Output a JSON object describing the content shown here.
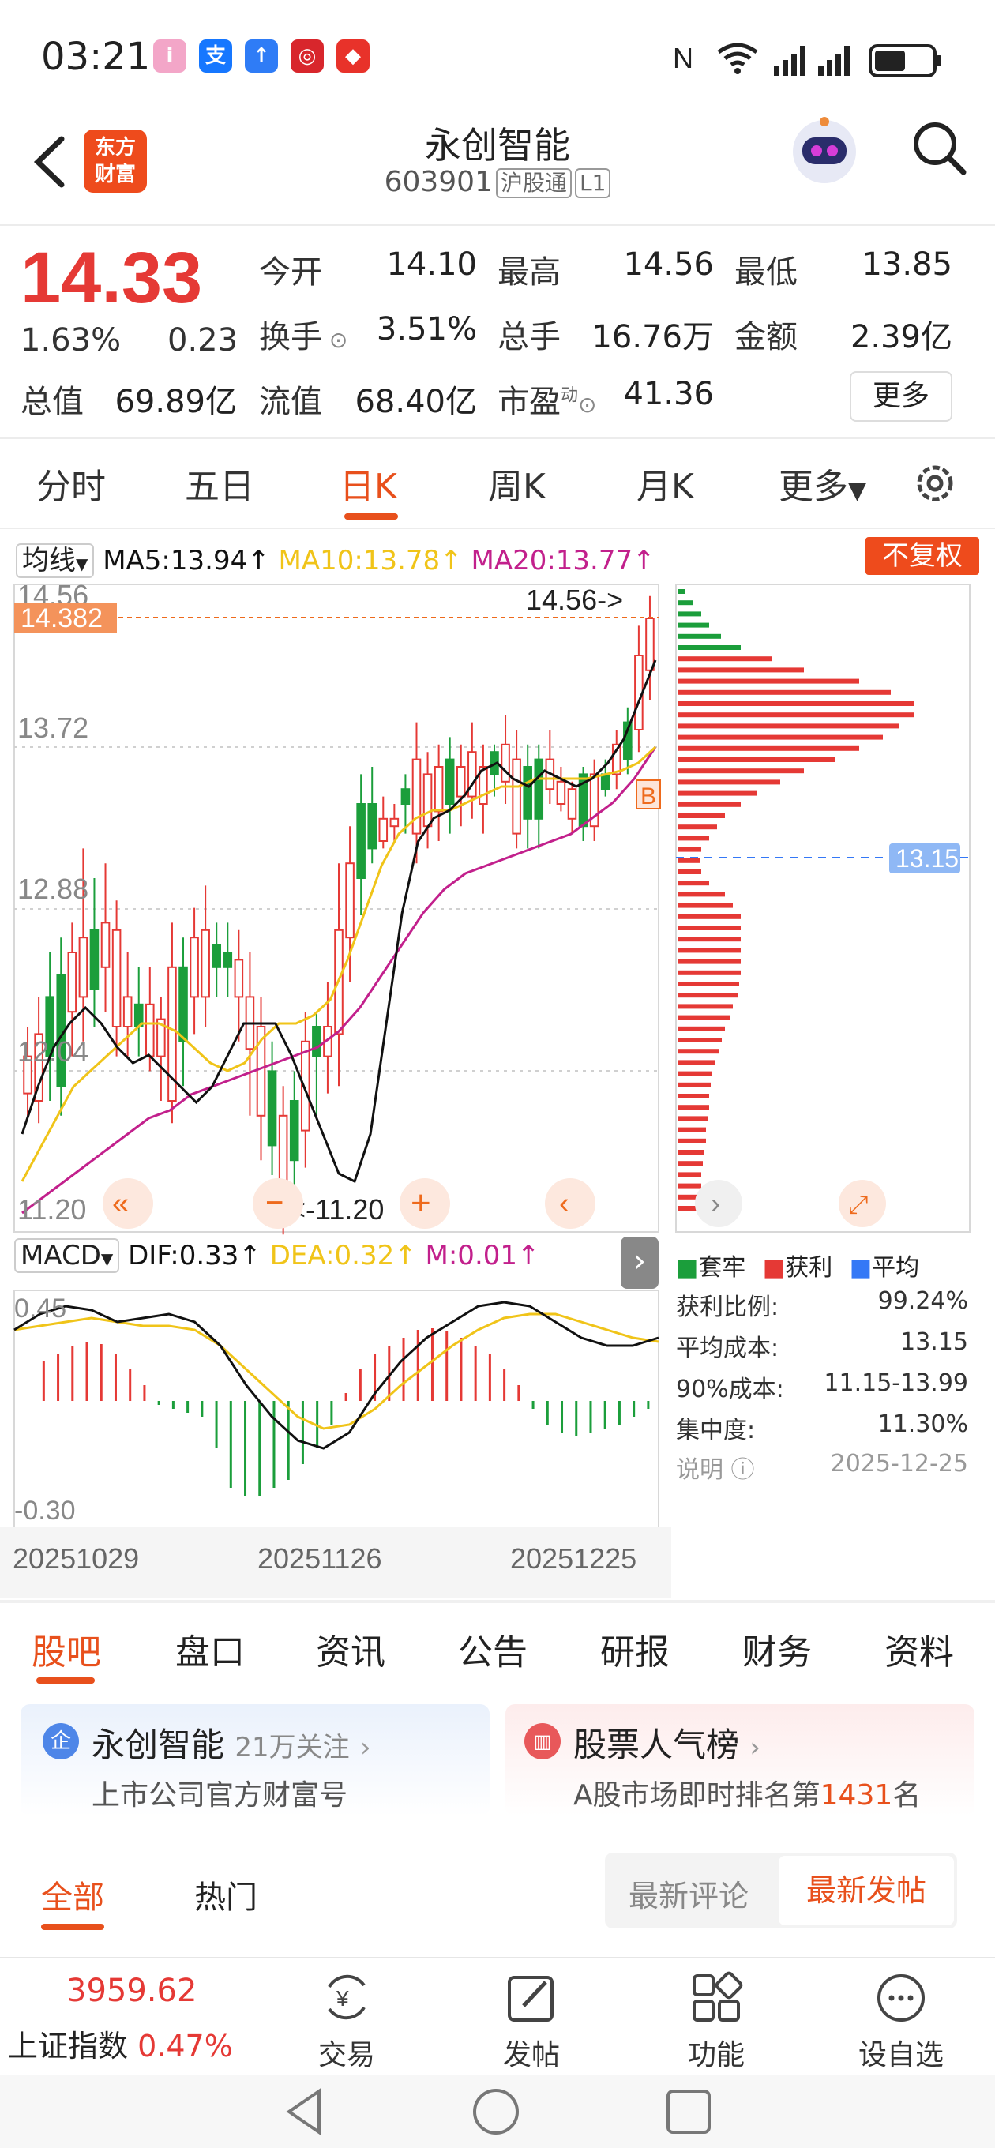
{
  "status": {
    "time": "03:21"
  },
  "header": {
    "logo_line1": "东方",
    "logo_line2": "财富",
    "title": "永创智能",
    "code": "603901",
    "tag1": "沪股通",
    "tag2": "L1"
  },
  "quote": {
    "price": "14.33",
    "pct": "1.63%",
    "change": "0.23",
    "rows": [
      {
        "label": "今开",
        "value": "14.10",
        "label2": "最高",
        "value2": "14.56",
        "label3": "最低",
        "value3": "13.85"
      },
      {
        "label": "换手",
        "value": "3.51%",
        "label2": "总手",
        "value2": "16.76万",
        "label3": "金额",
        "value3": "2.39亿"
      },
      {
        "label": "总值",
        "value": "69.89亿",
        "label2": "流值",
        "value2": "68.40亿",
        "label3": "市盈",
        "value3": "41.36",
        "sup3": "动"
      }
    ],
    "more": "更多"
  },
  "ktabs": [
    "分时",
    "五日",
    "日K",
    "周K",
    "月K",
    "更多"
  ],
  "ma": {
    "selector": "均线",
    "ma5": "MA5:13.94↑",
    "ma10": "MA10:13.78↑",
    "ma20": "MA20:13.77↑",
    "fuquan": "不复权",
    "colors": {
      "ma5": "#111111",
      "ma10": "#f0c419",
      "ma20": "#c2208c"
    }
  },
  "kchart": {
    "axis_labels": [
      "14.56",
      "13.72",
      "12.88",
      "12.04",
      "11.20"
    ],
    "cross_price": "14.382",
    "high_marker": "14.56->",
    "low_marker": "<-11.20",
    "b_marker": "B",
    "chip_avg_label": "13.15"
  },
  "macd": {
    "selector": "MACD",
    "dif": "DIF:0.33↑",
    "dea": "DEA:0.32↑",
    "m": "M:0.01↑",
    "top": "0.45",
    "bottom": "-0.30"
  },
  "dates": [
    "20251029",
    "20251126",
    "20251225"
  ],
  "chip": {
    "legend": [
      {
        "label": "套牢",
        "color": "#1b9e3b"
      },
      {
        "label": "获利",
        "color": "#e53935"
      },
      {
        "label": "平均",
        "color": "#3478f6"
      }
    ],
    "rows": [
      {
        "label": "获利比例:",
        "value": "99.24%"
      },
      {
        "label": "平均成本:",
        "value": "13.15"
      },
      {
        "label": "90%成本:",
        "value": "11.15-13.99"
      },
      {
        "label": "集中度:",
        "value": "11.30%"
      }
    ],
    "note": "说明",
    "date": "2025-12-25"
  },
  "btabs": [
    "股吧",
    "盘口",
    "资讯",
    "公告",
    "研报",
    "财务",
    "资料"
  ],
  "cards": {
    "c1_title": "永创智能",
    "c1_follow": "21万关注",
    "c1_sub": "上市公司官方财富号",
    "c2_title": "股票人气榜",
    "c2_sub_pre": "A股市场即时排名第",
    "c2_rank": "1431",
    "c2_sub_post": "名"
  },
  "subtabs": {
    "all": "全部",
    "hot": "热门",
    "latest_comment": "最新评论",
    "latest_post": "最新发帖"
  },
  "bottom": {
    "index_value": "3959.62",
    "index_name": "上证指数",
    "index_pct": "0.47%",
    "nav": [
      "交易",
      "发帖",
      "功能",
      "设自选"
    ]
  }
}
